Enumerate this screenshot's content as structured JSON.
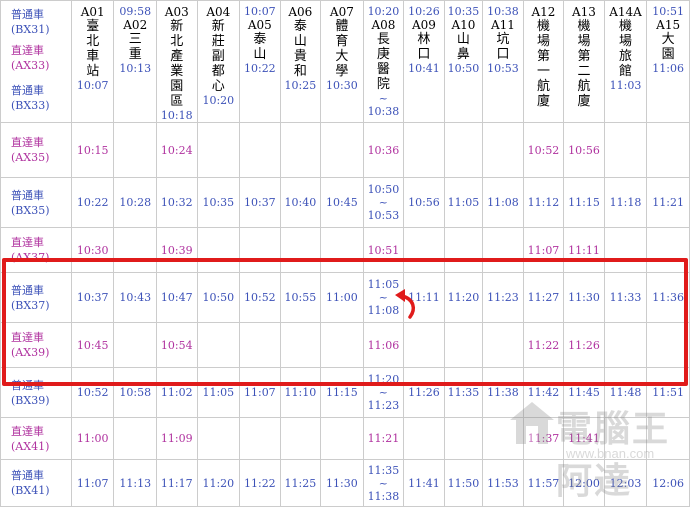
{
  "header": {
    "services": [
      {
        "name": "普通車",
        "code": "(BX31)"
      },
      {
        "name": "直達車",
        "code": "(AX33)"
      }
    ],
    "stations": [
      {
        "code": "A01",
        "name": "臺北車站",
        "chars": [
          "臺",
          "北",
          "車",
          "站"
        ],
        "time": ""
      },
      {
        "code": "A02",
        "name": "三重",
        "chars": [
          "三",
          "重"
        ],
        "time": "09:58"
      },
      {
        "code": "A03",
        "name": "新北產業園區",
        "chars": [
          "新",
          "北",
          "產",
          "業",
          "園",
          "區"
        ],
        "time": ""
      },
      {
        "code": "A04",
        "name": "新莊副都心",
        "chars": [
          "新",
          "莊",
          "副",
          "都",
          "心"
        ],
        "time": ""
      },
      {
        "code": "A05",
        "name": "泰山",
        "chars": [
          "泰",
          "山"
        ],
        "time": "10:07"
      },
      {
        "code": "A06",
        "name": "泰山貴和",
        "chars": [
          "泰",
          "山",
          "貴",
          "和"
        ],
        "time": ""
      },
      {
        "code": "A07",
        "name": "體育大學",
        "chars": [
          "體",
          "育",
          "大",
          "學"
        ],
        "time": ""
      },
      {
        "code": "A08",
        "name": "長庚醫院",
        "chars": [
          "長",
          "庚",
          "醫",
          "院"
        ],
        "time": "10:20"
      },
      {
        "code": "A09",
        "name": "林口",
        "chars": [
          "林",
          "口"
        ],
        "time": "10:26"
      },
      {
        "code": "A10",
        "name": "山鼻",
        "chars": [
          "山",
          "鼻"
        ],
        "time": "10:35"
      },
      {
        "code": "A11",
        "name": "坑口",
        "chars": [
          "坑",
          "口"
        ],
        "time": "10:38"
      },
      {
        "code": "A12",
        "name": "機場第一航廈",
        "chars": [
          "機",
          "場",
          "第",
          "一",
          "航",
          "廈"
        ],
        "time": ""
      },
      {
        "code": "A13",
        "name": "機場第二航廈",
        "chars": [
          "機",
          "場",
          "第",
          "二",
          "航",
          "廈"
        ],
        "time": ""
      },
      {
        "code": "A14A",
        "name": "機場旅館",
        "chars": [
          "機",
          "場",
          "旅",
          "館"
        ],
        "time": ""
      },
      {
        "code": "A15",
        "name": "大園",
        "chars": [
          "大",
          "園"
        ],
        "time": "10:51"
      }
    ]
  },
  "rows": [
    {
      "type": "normal",
      "name": "普通車",
      "code": "(BX33)",
      "times": [
        "10:07",
        "10:13",
        "10:18",
        "10:20",
        "10:22",
        "10:25",
        "10:30",
        "~\n10:38",
        "10:41",
        "10:50",
        "10:53",
        "",
        "",
        "11:03",
        "11:06"
      ]
    },
    {
      "type": "express",
      "name": "直達車",
      "code": "(AX35)",
      "times": [
        "10:15",
        "",
        "10:24",
        "",
        "",
        "",
        "",
        "10:36",
        "",
        "",
        "",
        "10:52",
        "10:56",
        "",
        ""
      ]
    },
    {
      "type": "normal",
      "name": "普通車",
      "code": "(BX35)",
      "times": [
        "10:22",
        "10:28",
        "10:32",
        "10:35",
        "10:37",
        "10:40",
        "10:45",
        "10:50\n~\n10:53",
        "10:56",
        "11:05",
        "11:08",
        "11:12",
        "11:15",
        "11:18",
        "11:21"
      ]
    },
    {
      "type": "express",
      "name": "直達車",
      "code": "(AX37)",
      "times": [
        "10:30",
        "",
        "10:39",
        "",
        "",
        "",
        "",
        "10:51",
        "",
        "",
        "",
        "11:07",
        "11:11",
        "",
        ""
      ]
    },
    {
      "type": "normal",
      "name": "普通車",
      "code": "(BX37)",
      "times": [
        "10:37",
        "10:43",
        "10:47",
        "10:50",
        "10:52",
        "10:55",
        "11:00",
        "11:05\n~\n11:08",
        "11:11",
        "11:20",
        "11:23",
        "11:27",
        "11:30",
        "11:33",
        "11:36"
      ]
    },
    {
      "type": "express",
      "name": "直達車",
      "code": "(AX39)",
      "times": [
        "10:45",
        "",
        "10:54",
        "",
        "",
        "",
        "",
        "11:06",
        "",
        "",
        "",
        "11:22",
        "11:26",
        "",
        ""
      ]
    },
    {
      "type": "normal",
      "name": "普通車",
      "code": "(BX39)",
      "times": [
        "10:52",
        "10:58",
        "11:02",
        "11:05",
        "11:07",
        "11:10",
        "11:15",
        "11:20\n~\n11:23",
        "11:26",
        "11:35",
        "11:38",
        "11:42",
        "11:45",
        "11:48",
        "11:51"
      ]
    },
    {
      "type": "express",
      "name": "直達車",
      "code": "(AX41)",
      "times": [
        "11:00",
        "",
        "11:09",
        "",
        "",
        "",
        "",
        "11:21",
        "",
        "",
        "",
        "11:37",
        "11:41",
        "",
        ""
      ]
    },
    {
      "type": "normal",
      "name": "普通車",
      "code": "(BX41)",
      "times": [
        "11:07",
        "11:13",
        "11:17",
        "11:20",
        "11:22",
        "11:25",
        "11:30",
        "11:35\n~\n11:38",
        "11:41",
        "11:50",
        "11:53",
        "11:57",
        "12:00",
        "12:03",
        "12:06"
      ]
    }
  ],
  "watermark": {
    "text": "電腦王阿達",
    "url": "www.bnan.com"
  },
  "colors": {
    "normal": "#3d52b8",
    "express": "#b0329f",
    "highlight": "#e01b1b",
    "grid": "#cccccc"
  }
}
